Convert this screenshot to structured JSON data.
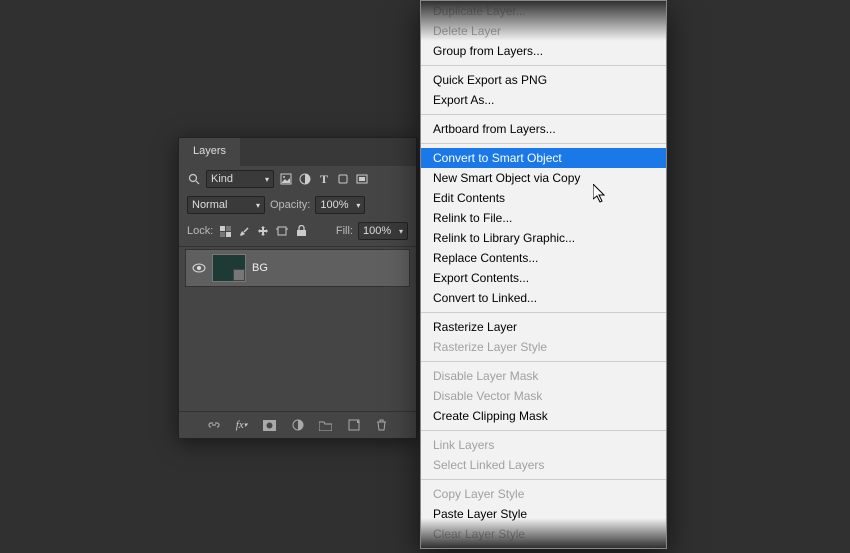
{
  "panel": {
    "tab": "Layers",
    "filter": {
      "kind": "Kind"
    },
    "blend": {
      "mode": "Normal",
      "opacityLabel": "Opacity:",
      "opacity": "100%"
    },
    "lock": {
      "label": "Lock:",
      "fillLabel": "Fill:",
      "fill": "100%"
    },
    "layer": {
      "name": "BG"
    },
    "icons": {
      "search": "⌕"
    }
  },
  "ctx": {
    "items": [
      {
        "t": "Duplicate Layer...",
        "d": true
      },
      {
        "t": "Delete Layer",
        "d": true
      },
      {
        "t": "Group from Layers...",
        "d": false
      },
      {
        "sep": true
      },
      {
        "t": "Quick Export as PNG",
        "d": false
      },
      {
        "t": "Export As...",
        "d": false
      },
      {
        "sep": true
      },
      {
        "t": "Artboard from Layers...",
        "d": false
      },
      {
        "sep": true
      },
      {
        "t": "Convert to Smart Object",
        "d": false,
        "hi": true
      },
      {
        "t": "New Smart Object via Copy",
        "d": false
      },
      {
        "t": "Edit Contents",
        "d": false
      },
      {
        "t": "Relink to File...",
        "d": false
      },
      {
        "t": "Relink to Library Graphic...",
        "d": false
      },
      {
        "t": "Replace Contents...",
        "d": false
      },
      {
        "t": "Export Contents...",
        "d": false
      },
      {
        "t": "Convert to Linked...",
        "d": false
      },
      {
        "sep": true
      },
      {
        "t": "Rasterize Layer",
        "d": false
      },
      {
        "t": "Rasterize Layer Style",
        "d": true
      },
      {
        "sep": true
      },
      {
        "t": "Disable Layer Mask",
        "d": true
      },
      {
        "t": "Disable Vector Mask",
        "d": true
      },
      {
        "t": "Create Clipping Mask",
        "d": false
      },
      {
        "sep": true
      },
      {
        "t": "Link Layers",
        "d": true
      },
      {
        "t": "Select Linked Layers",
        "d": true
      },
      {
        "sep": true
      },
      {
        "t": "Copy Layer Style",
        "d": true
      },
      {
        "t": "Paste Layer Style",
        "d": false
      },
      {
        "t": "Clear Layer Style",
        "d": true
      }
    ]
  }
}
